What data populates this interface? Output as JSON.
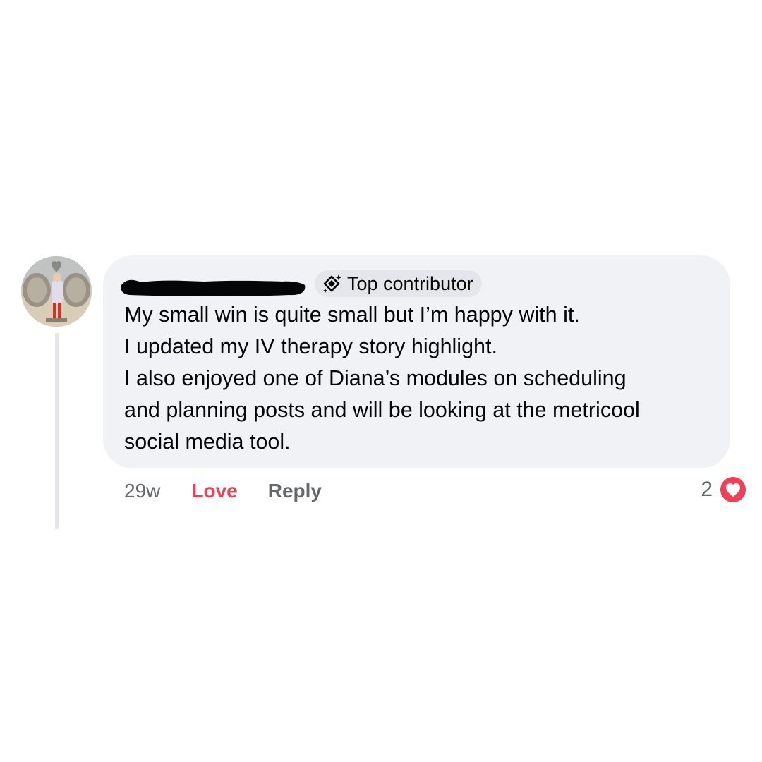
{
  "comment": {
    "author_name": "",
    "badge": {
      "label": "Top contributor",
      "icon": "diamond-sparkle-icon"
    },
    "body_lines": [
      "My small win is quite small but I’m happy with it.",
      "I updated my IV therapy story highlight.",
      "I also enjoyed one of Diana’s modules on scheduling",
      "and planning posts and will be looking at the metricool",
      "social media tool."
    ],
    "timestamp": "29w",
    "actions": {
      "love_label": "Love",
      "reply_label": "Reply"
    },
    "reactions": {
      "count": "2",
      "icon": "heart-reaction-icon"
    }
  },
  "colors": {
    "bubble_bg": "#f0f2f5",
    "love_accent": "#f33e58",
    "muted_text": "#65676b",
    "badge_bg": "#e4e6eb"
  }
}
